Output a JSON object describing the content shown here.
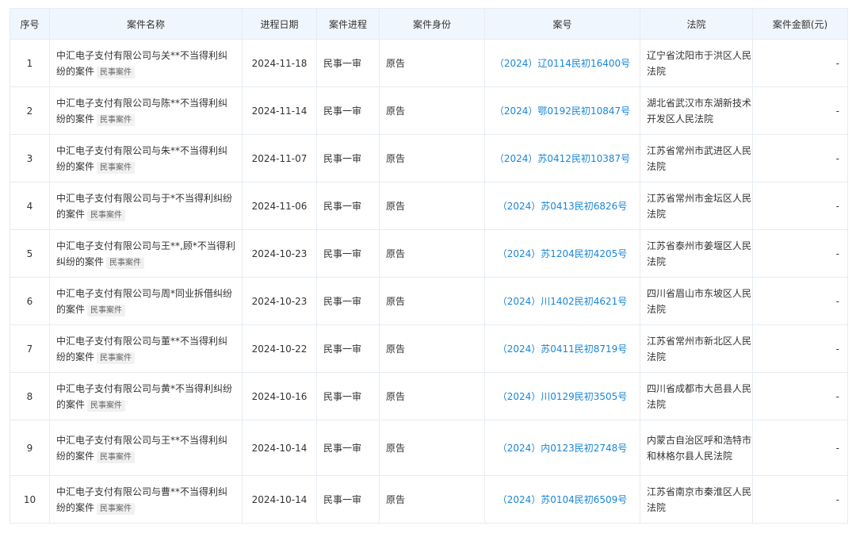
{
  "headers": [
    "序号",
    "案件名称",
    "进程日期",
    "案件进程",
    "案件身份",
    "案号",
    "法院",
    "案件金额(元)"
  ],
  "rows": [
    {
      "no": "1",
      "name": "中汇电子支付有限公司与关**不当得利纠纷的案件",
      "tag": "民事案件",
      "date": "2024-11-18",
      "stage": "民事一审",
      "role": "原告",
      "case_no": "（2024）辽0114民初16400号",
      "court": "辽宁省沈阳市于洪区人民法院",
      "amount": "-"
    },
    {
      "no": "2",
      "name": "中汇电子支付有限公司与陈**不当得利纠纷的案件",
      "tag": "民事案件",
      "date": "2024-11-14",
      "stage": "民事一审",
      "role": "原告",
      "case_no": "（2024）鄂0192民初10847号",
      "court": "湖北省武汉市东湖新技术开发区人民法院",
      "amount": "-"
    },
    {
      "no": "3",
      "name": "中汇电子支付有限公司与朱**不当得利纠纷的案件",
      "tag": "民事案件",
      "date": "2024-11-07",
      "stage": "民事一审",
      "role": "原告",
      "case_no": "（2024）苏0412民初10387号",
      "court": "江苏省常州市武进区人民法院",
      "amount": "-"
    },
    {
      "no": "4",
      "name": "中汇电子支付有限公司与于*不当得利纠纷的案件",
      "tag": "民事案件",
      "date": "2024-11-06",
      "stage": "民事一审",
      "role": "原告",
      "case_no": "（2024）苏0413民初6826号",
      "court": "江苏省常州市金坛区人民法院",
      "amount": "-"
    },
    {
      "no": "5",
      "name": "中汇电子支付有限公司与王**,顾*不当得利纠纷的案件",
      "tag": "民事案件",
      "date": "2024-10-23",
      "stage": "民事一审",
      "role": "原告",
      "case_no": "（2024）苏1204民初4205号",
      "court": "江苏省泰州市姜堰区人民法院",
      "amount": "-"
    },
    {
      "no": "6",
      "name": "中汇电子支付有限公司与周*同业拆借纠纷的案件",
      "tag": "民事案件",
      "date": "2024-10-23",
      "stage": "民事一审",
      "role": "原告",
      "case_no": "（2024）川1402民初4621号",
      "court": "四川省眉山市东坡区人民法院",
      "amount": "-"
    },
    {
      "no": "7",
      "name": "中汇电子支付有限公司与董**不当得利纠纷的案件",
      "tag": "民事案件",
      "date": "2024-10-22",
      "stage": "民事一审",
      "role": "原告",
      "case_no": "（2024）苏0411民初8719号",
      "court": "江苏省常州市新北区人民法院",
      "amount": "-"
    },
    {
      "no": "8",
      "name": "中汇电子支付有限公司与黄*不当得利纠纷的案件",
      "tag": "民事案件",
      "date": "2024-10-16",
      "stage": "民事一审",
      "role": "原告",
      "case_no": "（2024）川0129民初3505号",
      "court": "四川省成都市大邑县人民法院",
      "amount": "-"
    },
    {
      "no": "9",
      "name": "中汇电子支付有限公司与王**不当得利纠纷的案件",
      "tag": "民事案件",
      "date": "2024-10-14",
      "stage": "民事一审",
      "role": "原告",
      "case_no": "（2024）内0123民初2748号",
      "court": "内蒙古自治区呼和浩特市和林格尔县人民法院",
      "amount": "-"
    },
    {
      "no": "10",
      "name": "中汇电子支付有限公司与曹**不当得利纠纷的案件",
      "tag": "民事案件",
      "date": "2024-10-14",
      "stage": "民事一审",
      "role": "原告",
      "case_no": "（2024）苏0104民初6509号",
      "court": "江苏省南京市秦淮区人民法院",
      "amount": "-"
    }
  ]
}
